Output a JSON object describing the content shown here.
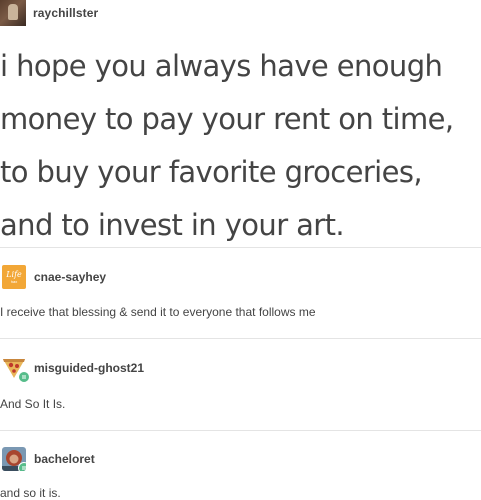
{
  "original_post": {
    "username": "raychillster",
    "lines": [
      "i hope you always have enough",
      "money to pay your rent on time,",
      "to buy your favorite groceries,",
      "and to invest in your art."
    ]
  },
  "avatar_text": {
    "life": "Life",
    "life_sub": "hax"
  },
  "replies": [
    {
      "username": "cnae-sayhey",
      "text": "I receive that blessing & send it to everyone that follows me",
      "avatar": "life-hax-icon"
    },
    {
      "username": "misguided-ghost21",
      "text": "And So It Is.",
      "avatar": "pizza-slice-icon"
    },
    {
      "username": "bacheloret",
      "text": "and so it is.",
      "avatar": "profile-photo-icon"
    }
  ],
  "colors": {
    "text": "#444444",
    "divider": "#e4e4e4",
    "reblog_badge": "#56bc8a",
    "life_avatar": "#f2a737"
  }
}
